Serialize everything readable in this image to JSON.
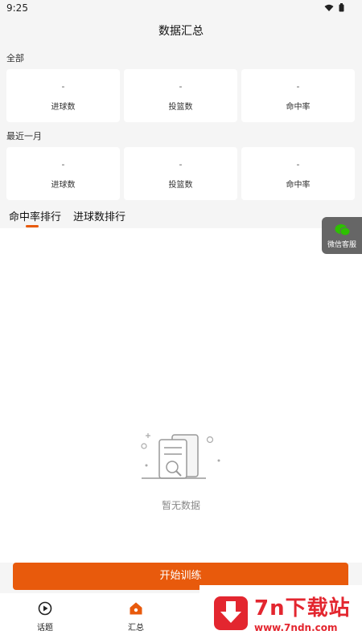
{
  "status_bar": {
    "time": "9:25"
  },
  "header": {
    "title": "数据汇总"
  },
  "all_section": {
    "label": "全部",
    "cards": [
      {
        "value": "-",
        "label": "进球数"
      },
      {
        "value": "-",
        "label": "投篮数"
      },
      {
        "value": "-",
        "label": "命中率"
      }
    ]
  },
  "month_section": {
    "label": "最近一月",
    "cards": [
      {
        "value": "-",
        "label": "进球数"
      },
      {
        "value": "-",
        "label": "投篮数"
      },
      {
        "value": "-",
        "label": "命中率"
      }
    ]
  },
  "tabs": [
    {
      "label": "命中率排行",
      "active": true
    },
    {
      "label": "进球数排行",
      "active": false
    }
  ],
  "empty_state": {
    "text": "暂无数据"
  },
  "customer_service": {
    "label": "微信客服"
  },
  "start_button": {
    "label": "开始训练"
  },
  "bottom_nav": [
    {
      "label": "话题",
      "icon": "play-circle-icon"
    },
    {
      "label": "汇总",
      "icon": "home-icon",
      "active": true
    }
  ],
  "watermark": {
    "title": "7n下载站",
    "url": "www.7ndn.com"
  },
  "colors": {
    "accent": "#e85a0c",
    "background": "#f5f5f5",
    "watermark_red": "#e3262f",
    "wechat_green": "#2dc100"
  }
}
